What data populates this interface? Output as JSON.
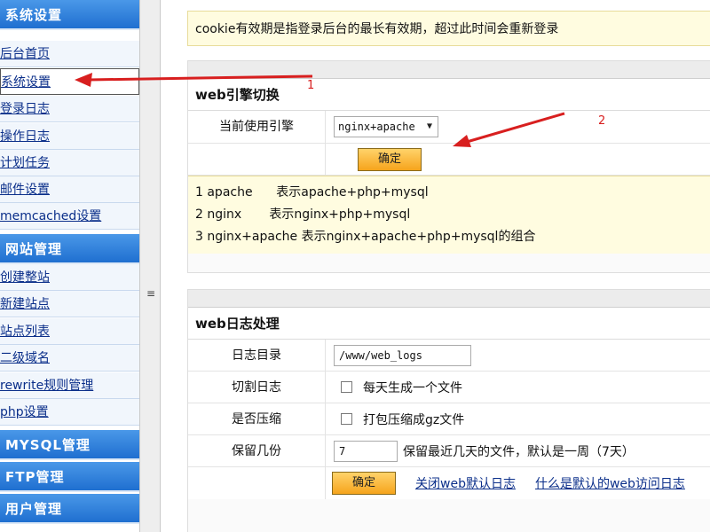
{
  "sidebar": {
    "sections": [
      {
        "title": "系统设置",
        "items": [
          "后台首页",
          "系统设置",
          "登录日志",
          "操作日志",
          "计划任务",
          "邮件设置",
          "memcached设置"
        ]
      },
      {
        "title": "网站管理",
        "items": [
          "创建整站",
          "新建站点",
          "站点列表",
          "二级域名",
          "rewrite规则管理",
          "php设置"
        ]
      },
      {
        "title": "MYSQL管理",
        "items": []
      },
      {
        "title": "FTP管理",
        "items": []
      },
      {
        "title": "用户管理",
        "items": []
      }
    ],
    "active_item": "系统设置"
  },
  "splitter": {
    "glyph": "≡"
  },
  "main": {
    "cookie_note": "cookie有效期是指登录后台的最长有效期，超过此时间会重新登录",
    "engine_panel": {
      "title": "web引擎切换",
      "engine_label": "当前使用引擎",
      "engine_value": "nginx+apache",
      "confirm": "确定",
      "info_lines": [
        "1 apache      表示apache+php+mysql",
        "2 nginx       表示nginx+php+mysql",
        "3 nginx+apache 表示nginx+apache+php+mysql的组合"
      ]
    },
    "log_panel": {
      "title": "web日志处理",
      "dir_label": "日志目录",
      "dir_value": "/www/web_logs",
      "split_label": "切割日志",
      "split_option": "每天生成一个文件",
      "compress_label": "是否压缩",
      "compress_option": "打包压缩成gz文件",
      "keep_label": "保留几份",
      "keep_value": "7",
      "keep_hint": "保留最近几天的文件，默认是一周（7天）",
      "confirm": "确定",
      "link_close": "关闭web默认日志",
      "link_what": "什么是默认的web访问日志"
    }
  },
  "annotations": {
    "arrow1_label": "1",
    "arrow2_label": "2",
    "arrow_color": "#d81f1f"
  }
}
